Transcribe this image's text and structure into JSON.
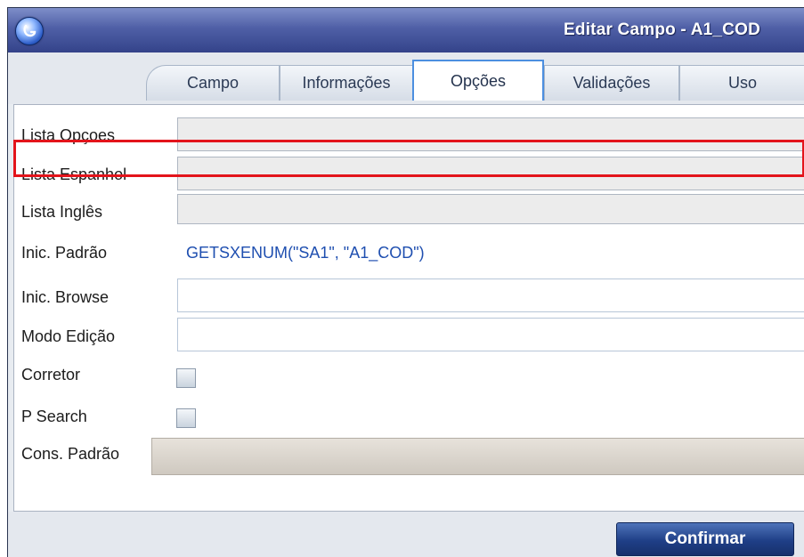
{
  "window": {
    "title": "Editar Campo - A1_COD"
  },
  "tabs": [
    {
      "label": "Campo"
    },
    {
      "label": "Informações"
    },
    {
      "label": "Opções"
    },
    {
      "label": "Validações"
    },
    {
      "label": "Uso"
    }
  ],
  "active_tab": "Opções",
  "form": {
    "lista_opcoes": {
      "label": "Lista Opçoes",
      "value": ""
    },
    "lista_espanhol": {
      "label": "Lista Espanhol",
      "value": ""
    },
    "lista_ingles": {
      "label": "Lista Inglês",
      "value": ""
    },
    "inic_padrao": {
      "label": "Inic. Padrão",
      "value": "GETSXENUM(\"SA1\", \"A1_COD\")"
    },
    "inic_browse": {
      "label": "Inic. Browse",
      "value": ""
    },
    "modo_edicao": {
      "label": "Modo Edição",
      "value": ""
    },
    "corretor": {
      "label": "Corretor",
      "checked": false
    },
    "p_search": {
      "label": "P Search",
      "checked": false
    },
    "cons_padrao": {
      "label": "Cons. Padrão",
      "value": ""
    }
  },
  "footer": {
    "confirm_label": "Confirmar"
  },
  "colors": {
    "highlight": "#e3141b",
    "title_bar": "#4f5fa6",
    "active_tab_border": "#4c8fe0",
    "field_value": "#1f4fb0"
  }
}
